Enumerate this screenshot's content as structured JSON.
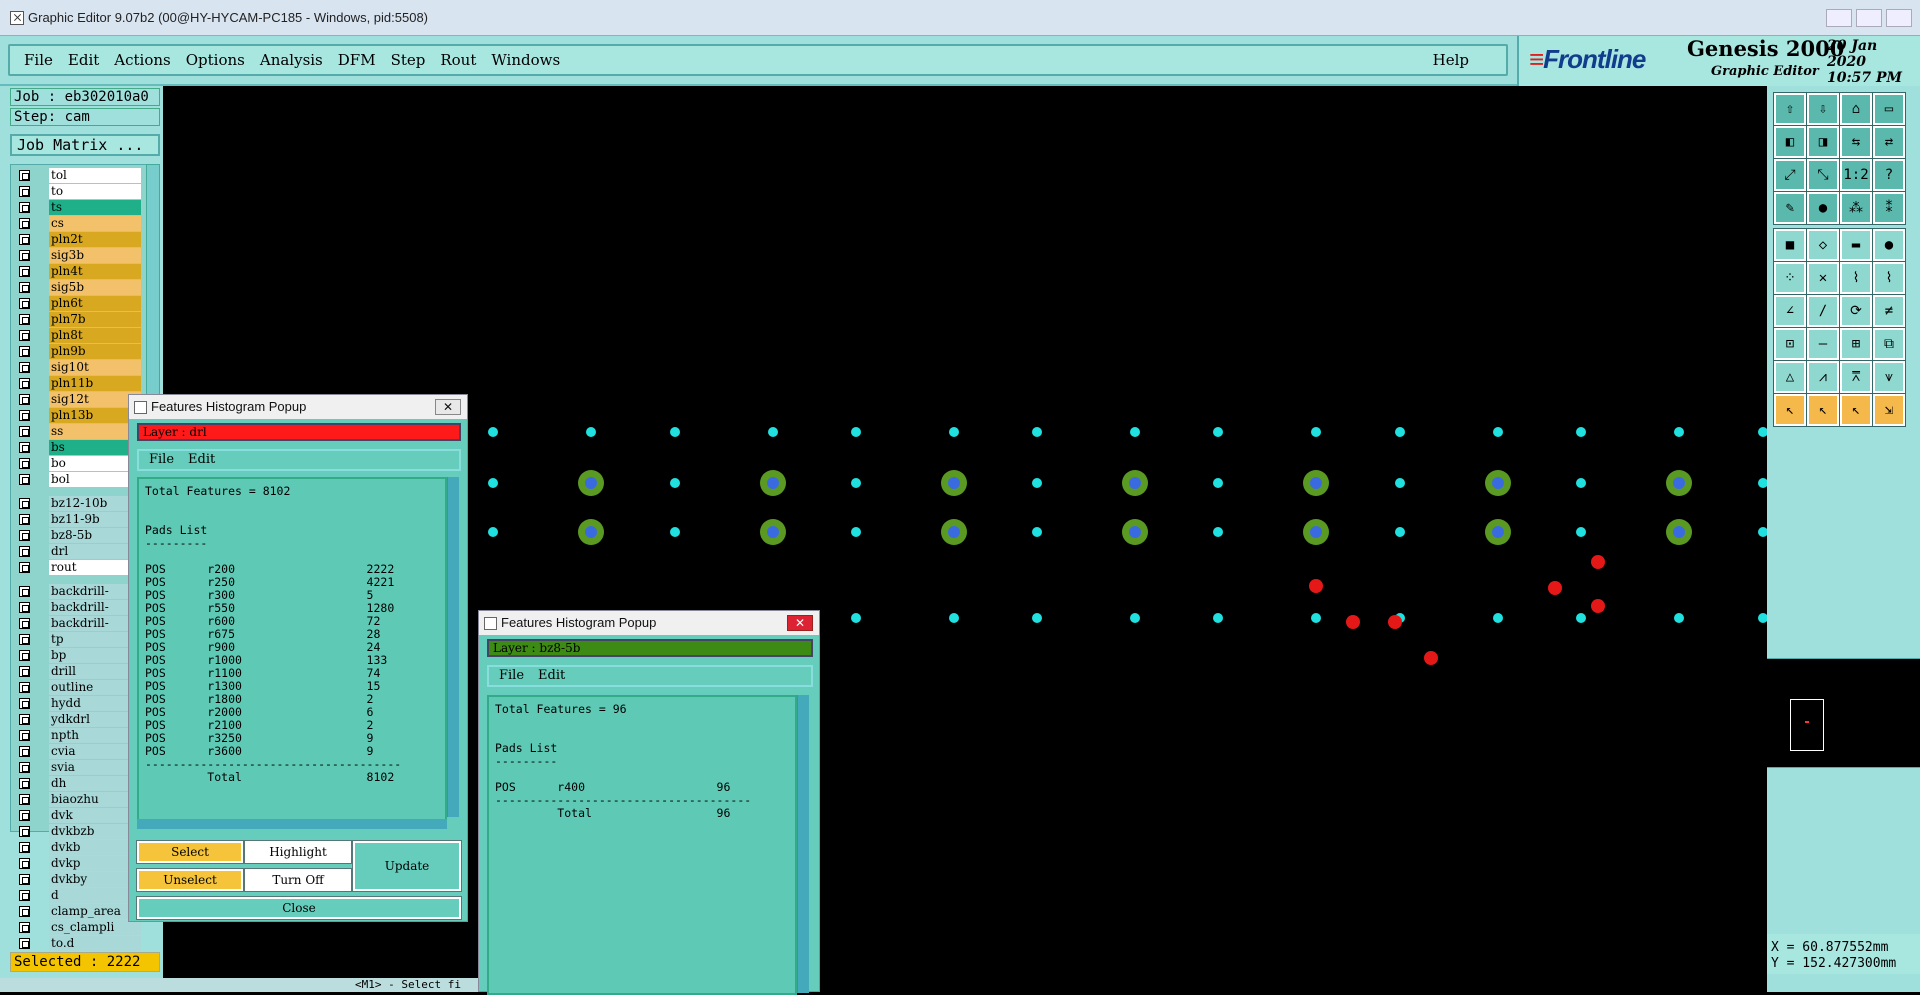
{
  "window": {
    "title": "Graphic Editor 9.07b2 (00@HY-HYCAM-PC185 - Windows, pid:5508)"
  },
  "menubar": {
    "items": [
      "File",
      "Edit",
      "Actions",
      "Options",
      "Analysis",
      "DFM",
      "Step",
      "Rout",
      "Windows"
    ],
    "help": "Help"
  },
  "brand": {
    "logo": "Frontline",
    "product": "Genesis 2000",
    "subtitle": "Graphic Editor",
    "date": "20 Jan 2020",
    "time": "10:57 PM"
  },
  "job": {
    "job_label": "Job : eb302010a0",
    "step_label": "Step: cam",
    "job_matrix": "Job Matrix ..."
  },
  "layers": [
    {
      "name": "tol",
      "color": "#ffffff"
    },
    {
      "name": "to",
      "color": "#ffffff"
    },
    {
      "name": "ts",
      "color": "#1fb08a"
    },
    {
      "name": "cs",
      "color": "#f2c16a"
    },
    {
      "name": "pln2t",
      "color": "#d8a820"
    },
    {
      "name": "sig3b",
      "color": "#f2c16a"
    },
    {
      "name": "pln4t",
      "color": "#d8a820"
    },
    {
      "name": "sig5b",
      "color": "#f2c16a"
    },
    {
      "name": "pln6t",
      "color": "#d8a820"
    },
    {
      "name": "pln7b",
      "color": "#d8a820"
    },
    {
      "name": "pln8t",
      "color": "#d8a820"
    },
    {
      "name": "pln9b",
      "color": "#d8a820"
    },
    {
      "name": "sig10t",
      "color": "#f2c16a"
    },
    {
      "name": "pln11b",
      "color": "#d8a820"
    },
    {
      "name": "sig12t",
      "color": "#f2c16a"
    },
    {
      "name": "pln13b",
      "color": "#d8a820"
    },
    {
      "name": "ss",
      "color": "#f2c16a"
    },
    {
      "name": "bs",
      "color": "#1fb08a"
    },
    {
      "name": "bo",
      "color": "#ffffff"
    },
    {
      "name": "bol",
      "color": "#ffffff"
    },
    {
      "name": "bz12-10b",
      "color": "#a8d8d8"
    },
    {
      "name": "bz11-9b",
      "color": "#a8d8d8"
    },
    {
      "name": "bz8-5b",
      "color": "#a8d8d8"
    },
    {
      "name": "drl",
      "color": "#a8d8d8"
    },
    {
      "name": "rout",
      "color": "#ffffff"
    },
    {
      "name": "backdrill-",
      "color": "#a8d8d8"
    },
    {
      "name": "backdrill-",
      "color": "#a8d8d8"
    },
    {
      "name": "backdrill-",
      "color": "#a8d8d8"
    },
    {
      "name": "tp",
      "color": "#a8d8d8"
    },
    {
      "name": "bp",
      "color": "#a8d8d8"
    },
    {
      "name": "drill",
      "color": "#a8d8d8"
    },
    {
      "name": "outline",
      "color": "#a8d8d8"
    },
    {
      "name": "hydd",
      "color": "#a8d8d8"
    },
    {
      "name": "ydkdrl",
      "color": "#a8d8d8"
    },
    {
      "name": "npth",
      "color": "#a8d8d8"
    },
    {
      "name": "cvia",
      "color": "#a8d8d8"
    },
    {
      "name": "svia",
      "color": "#a8d8d8"
    },
    {
      "name": "dh",
      "color": "#a8d8d8"
    },
    {
      "name": "biaozhu",
      "color": "#a8d8d8"
    },
    {
      "name": "dvk",
      "color": "#a8d8d8"
    },
    {
      "name": "dvkbzb",
      "color": "#a8d8d8"
    },
    {
      "name": "dvkb",
      "color": "#a8d8d8"
    },
    {
      "name": "dvkp",
      "color": "#a8d8d8"
    },
    {
      "name": "dvkby",
      "color": "#a8d8d8"
    },
    {
      "name": "d",
      "color": "#a8d8d8"
    },
    {
      "name": "clamp_area",
      "color": "#a8d8d8"
    },
    {
      "name": "cs_clampli",
      "color": "#a8d8d8"
    },
    {
      "name": "to.d",
      "color": "#a8d8d8"
    }
  ],
  "status": {
    "selected": "Selected : 2222",
    "coord_x": "X = 60.877552mm",
    "coord_y": "Y = 152.427300mm",
    "bottom_hint": "<M1> - Select fi"
  },
  "popup1": {
    "title": "Features Histogram Popup",
    "layer": "Layer :  drl",
    "menu": [
      "File",
      "Edit"
    ],
    "total": "Total Features = 8102",
    "pads_heading": "Pads List",
    "rows": [
      [
        "POS",
        "r200",
        "2222"
      ],
      [
        "POS",
        "r250",
        "4221"
      ],
      [
        "POS",
        "r300",
        "5"
      ],
      [
        "POS",
        "r550",
        "1280"
      ],
      [
        "POS",
        "r600",
        "72"
      ],
      [
        "POS",
        "r675",
        "28"
      ],
      [
        "POS",
        "r900",
        "24"
      ],
      [
        "POS",
        "r1000",
        "133"
      ],
      [
        "POS",
        "r1100",
        "74"
      ],
      [
        "POS",
        "r1300",
        "15"
      ],
      [
        "POS",
        "r1800",
        "2"
      ],
      [
        "POS",
        "r2000",
        "6"
      ],
      [
        "POS",
        "r2100",
        "2"
      ],
      [
        "POS",
        "r3250",
        "9"
      ],
      [
        "POS",
        "r3600",
        "9"
      ]
    ],
    "total_label": "Total",
    "total_value": "8102",
    "buttons": {
      "select": "Select",
      "highlight": "Highlight",
      "update": "Update",
      "unselect": "Unselect",
      "turnoff": "Turn Off",
      "close": "Close"
    }
  },
  "popup2": {
    "title": "Features Histogram Popup",
    "layer": "Layer :  bz8-5b",
    "menu": [
      "File",
      "Edit"
    ],
    "total": "Total Features = 96",
    "pads_heading": "Pads List",
    "rows": [
      [
        "POS",
        "r400",
        "96"
      ]
    ],
    "total_label": "Total",
    "total_value": "96"
  }
}
